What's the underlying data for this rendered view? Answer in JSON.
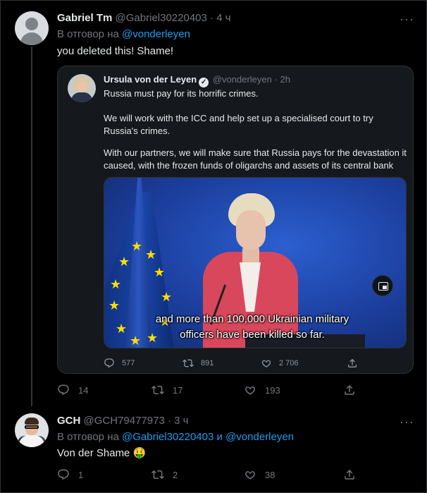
{
  "tweet1": {
    "name": "Gabriel Tm",
    "handle": "@Gabriel30220403",
    "time": "4 ч",
    "reply_prefix": "В отговор на",
    "reply_mention": "@vonderleyen",
    "text": "you deleted this! Shame!",
    "replies": "14",
    "retweets": "17",
    "likes": "193"
  },
  "quoted": {
    "name": "Ursula von der Leyen",
    "handle": "@vonderleyen",
    "time": "2h",
    "para1": "Russia must pay for its horrific crimes.",
    "para2": "We will work with the ICC and help set up a specialised court to try Russia's crimes.",
    "para3": "With our partners, we will make sure that Russia pays for the devastation it caused, with the frozen funds of oligarchs and assets of its central bank",
    "subtitle_line1": "and more than 100,000 Ukrainian military",
    "subtitle_line2": "officers have been killed so far.",
    "replies": "577",
    "retweets": "891",
    "likes": "2 706"
  },
  "tweet2": {
    "name": "GCH",
    "handle": "@GCH79477973",
    "time": "3 ч",
    "reply_prefix": "В отговор на",
    "reply_mention1": "@Gabriel30220403",
    "reply_and": "и",
    "reply_mention2": "@vonderleyen",
    "text": "Von der Shame",
    "emoji": "🤑",
    "replies": "1",
    "retweets": "2",
    "likes": "38"
  },
  "separator_dot": "·",
  "more_glyph": "···",
  "colors": {
    "background": "#000000",
    "text": "#e7e9ea",
    "muted": "#71767b",
    "link": "#1d9bf0",
    "quote_bg": "#15181c"
  },
  "icons": [
    "more-icon",
    "verified-badge-icon",
    "reply-icon",
    "retweet-icon",
    "like-icon",
    "share-icon",
    "picture-in-picture-icon"
  ]
}
